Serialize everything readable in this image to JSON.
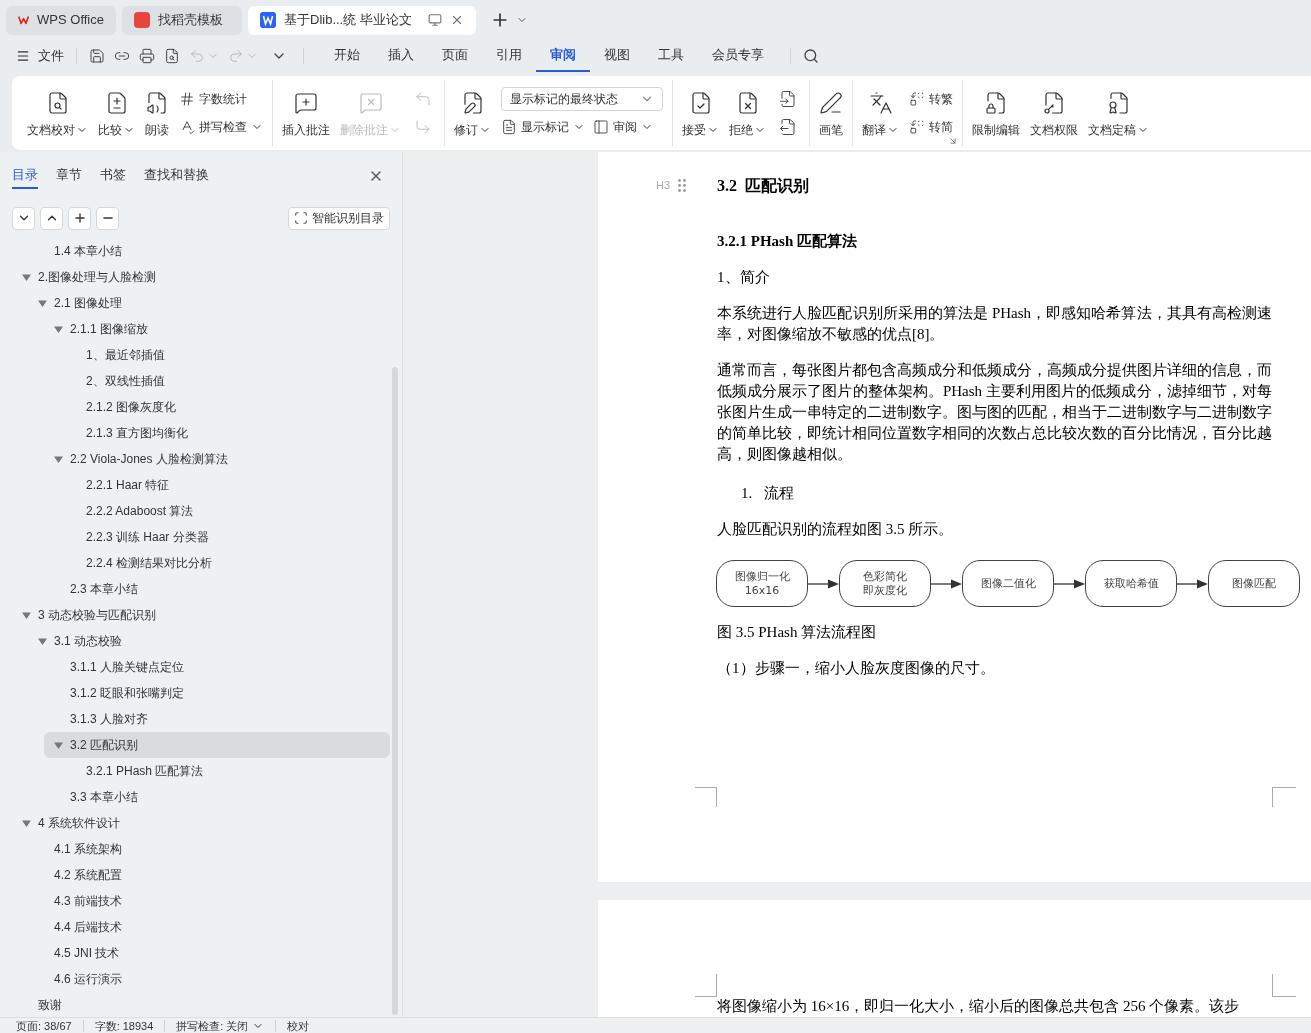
{
  "window_tabs": [
    {
      "label": "WPS Office",
      "selected": false
    },
    {
      "label": "找稻壳模板",
      "selected": false
    },
    {
      "label": "基于Dlib...统 毕业论文",
      "selected": true
    }
  ],
  "menu": {
    "file": "文件",
    "quick_access": [
      {
        "disabled": false,
        "dropdown": false
      },
      {
        "disabled": false,
        "dropdown": false
      },
      {
        "disabled": false,
        "dropdown": false
      },
      {
        "disabled": false,
        "dropdown": false
      },
      {
        "disabled": true,
        "dropdown": true
      },
      {
        "disabled": true,
        "dropdown": true
      }
    ],
    "tabs": [
      {
        "label": "开始",
        "selected": false
      },
      {
        "label": "插入",
        "selected": false
      },
      {
        "label": "页面",
        "selected": false
      },
      {
        "label": "引用",
        "selected": false
      },
      {
        "label": "审阅",
        "selected": true
      },
      {
        "label": "视图",
        "selected": false
      },
      {
        "label": "工具",
        "selected": false
      },
      {
        "label": "会员专享",
        "selected": false
      }
    ]
  },
  "ribbon": [
    {
      "items": [
        {
          "kind": "large",
          "label": "文档校对",
          "dropdown": true,
          "disabled": false
        },
        {
          "kind": "large",
          "label": "比较",
          "dropdown": true,
          "disabled": false
        },
        {
          "kind": "large",
          "label": "朗读",
          "dropdown": false,
          "disabled": false
        },
        {
          "kind": "stack",
          "rows": [
            [
              {
                "kind": "small",
                "label": "字数统计",
                "dropdown": false,
                "disabled": false
              }
            ],
            [
              {
                "kind": "small",
                "label": "拼写检查",
                "dropdown": true,
                "disabled": false
              }
            ]
          ]
        }
      ]
    },
    {
      "items": [
        {
          "kind": "large",
          "label": "插入批注",
          "dropdown": false,
          "disabled": false
        },
        {
          "kind": "large",
          "label": "删除批注",
          "dropdown": true,
          "disabled": true
        },
        {
          "kind": "stack",
          "rows": [
            [
              {
                "kind": "icon",
                "disabled": true
              }
            ],
            [
              {
                "kind": "icon",
                "disabled": true
              }
            ]
          ]
        }
      ]
    },
    {
      "items": [
        {
          "kind": "large",
          "label": "修订",
          "dropdown": true,
          "disabled": false
        },
        {
          "kind": "stack",
          "rows": [
            [
              {
                "kind": "select",
                "value": "显示标记的最终状态"
              }
            ],
            [
              {
                "kind": "small",
                "label": "显示标记",
                "dropdown": true,
                "disabled": false
              },
              {
                "kind": "small",
                "label": "审阅",
                "dropdown": true,
                "disabled": false
              }
            ]
          ]
        }
      ]
    },
    {
      "items": [
        {
          "kind": "large",
          "label": "接受",
          "dropdown": true,
          "disabled": false
        },
        {
          "kind": "large",
          "label": "拒绝",
          "dropdown": true,
          "disabled": false
        },
        {
          "kind": "stack",
          "rows": [
            [
              {
                "kind": "icon",
                "disabled": false
              }
            ],
            [
              {
                "kind": "icon",
                "disabled": false
              }
            ]
          ]
        }
      ]
    },
    {
      "items": [
        {
          "kind": "large",
          "label": "画笔",
          "dropdown": false,
          "disabled": false
        }
      ]
    },
    {
      "items": [
        {
          "kind": "large",
          "label": "翻译",
          "dropdown": true,
          "disabled": false
        },
        {
          "kind": "stack",
          "rows": [
            [
              {
                "kind": "small",
                "label": "转繁",
                "dropdown": false,
                "disabled": false
              }
            ],
            [
              {
                "kind": "small",
                "label": "转简",
                "dropdown": false,
                "disabled": false
              }
            ]
          ]
        }
      ],
      "launcher": true
    },
    {
      "items": [
        {
          "kind": "large",
          "label": "限制编辑",
          "dropdown": false,
          "disabled": false
        },
        {
          "kind": "large",
          "label": "文档权限",
          "dropdown": false,
          "disabled": false
        },
        {
          "kind": "large",
          "label": "文档定稿",
          "dropdown": true,
          "disabled": false
        }
      ]
    }
  ],
  "sidebar": {
    "tabs": [
      {
        "label": "目录",
        "selected": true
      },
      {
        "label": "章节",
        "selected": false
      },
      {
        "label": "书签",
        "selected": false
      },
      {
        "label": "查找和替换",
        "selected": false
      }
    ],
    "smart_button": "智能识别目录",
    "toc": [
      {
        "children": [
          {
            "label": "1.4 本章小结",
            "selected": false
          }
        ]
      },
      {
        "label": "2.图像处理与人脸检测",
        "selected": false,
        "expanded": true,
        "children": [
          {
            "label": "2.1 图像处理",
            "selected": false,
            "expanded": true,
            "children": [
              {
                "label": "2.1.1 图像缩放",
                "selected": false,
                "expanded": true,
                "children": [
                  {
                    "label": "1、最近邻插值",
                    "selected": false
                  },
                  {
                    "label": "2、双线性插值",
                    "selected": false
                  },
                  {
                    "label": "2.1.2 图像灰度化",
                    "selected": false
                  },
                  {
                    "label": "2.1.3 直方图均衡化",
                    "selected": false
                  }
                ]
              },
              {
                "label": "2.2 Viola-Jones 人脸检测算法",
                "selected": false,
                "expanded": true,
                "children": [
                  {
                    "label": "2.2.1 Haar 特征",
                    "selected": false
                  },
                  {
                    "label": "2.2.2 Adaboost 算法",
                    "selected": false
                  },
                  {
                    "label": "2.2.3  训练 Haar 分类器",
                    "selected": false
                  },
                  {
                    "label": "2.2.4 检测结果对比分析",
                    "selected": false
                  }
                ]
              },
              {
                "label": "2.3  本章小结",
                "selected": false
              }
            ]
          }
        ]
      },
      {
        "label": "3 动态校验与匹配识别",
        "selected": false,
        "expanded": true,
        "children": [
          {
            "label": "3.1  动态校验",
            "selected": false,
            "expanded": true,
            "children": [
              {
                "label": "3.1.1 人脸关键点定位",
                "selected": false
              },
              {
                "label": "3.1.2 眨眼和张嘴判定",
                "selected": false
              },
              {
                "label": "3.1.3  人脸对齐",
                "selected": false
              },
              {
                "label": "3.2  匹配识别",
                "selected": true,
                "expanded": true,
                "children": [
                  {
                    "label": "3.2.1 PHash 匹配算法",
                    "selected": false
                  }
                ]
              },
              {
                "label": "3.3  本章小结",
                "selected": false
              }
            ]
          }
        ]
      },
      {
        "label": "4 系统软件设计",
        "selected": false,
        "expanded": true,
        "children": [
          {
            "label": "4.1 系统架构",
            "selected": false
          },
          {
            "label": "4.2  系统配置",
            "selected": false
          },
          {
            "label": "4.3  前端技术",
            "selected": false
          },
          {
            "label": "4.4  后端技术",
            "selected": false
          },
          {
            "label": "4.5 JNI  技术",
            "selected": false
          },
          {
            "label": "4.6  运行演示",
            "selected": false
          }
        ]
      },
      {
        "label": "致谢",
        "selected": false
      }
    ]
  },
  "document": {
    "heading_marker": "H3",
    "heading": "3.2  匹配识别",
    "subheading": "3.2.1 PHash 匹配算法",
    "blocks": [
      {
        "kind": "para",
        "text": "1、简介"
      },
      {
        "kind": "para",
        "text": "本系统进行人脸匹配识别所采用的算法是 PHash，即感知哈希算法，其具有高检测速率，对图像缩放不敏感的优点[8]。"
      },
      {
        "kind": "para",
        "text": "通常而言，每张图片都包含高频成分和低频成分，高频成分提供图片详细的信息，而低频成分展示了图片的整体架构。PHash 主要利用图片的低频成分，滤掉细节，对每张图片生成一串特定的二进制数字。图与图的匹配，相当于二进制数字与二进制数字的简单比较，即统计相同位置数字相同的次数占总比较次数的百分比情况，百分比越高，则图像越相似。"
      },
      {
        "kind": "list",
        "number": "1.",
        "text": "流程"
      },
      {
        "kind": "para",
        "text": "人脸匹配识别的流程如图 3.5 所示。"
      },
      {
        "kind": "flowchart",
        "nodes": [
          [
            "图像归一化",
            "16x16"
          ],
          [
            "色彩简化",
            "即灰度化"
          ],
          [
            "图像二值化"
          ],
          [
            "获取哈希值"
          ],
          [
            "图像匹配"
          ]
        ]
      },
      {
        "kind": "para",
        "text": "图 3.5 PHash 算法流程图"
      },
      {
        "kind": "para",
        "text": "（1）步骤一，缩小人脸灰度图像的尺寸。"
      }
    ],
    "next_page_text": "将图像缩小为 16×16，即归一化大小，缩小后的图像总共包含 256 个像素。该步"
  },
  "status_bar": [
    {
      "label": "页面: 38/67",
      "dropdown": false
    },
    {
      "label": "字数: 18934",
      "dropdown": false
    },
    {
      "label": "拼写检查: 关闭",
      "dropdown": true
    },
    {
      "label": "校对",
      "dropdown": false
    }
  ]
}
